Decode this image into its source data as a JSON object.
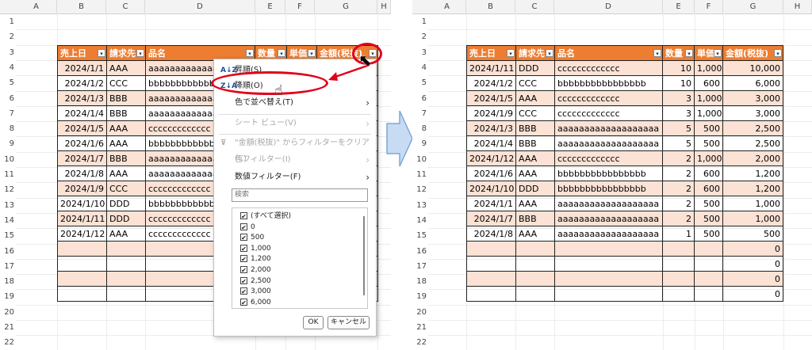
{
  "columns": [
    "A",
    "B",
    "C",
    "D",
    "E",
    "F",
    "G",
    "H"
  ],
  "rows": [
    "1",
    "2",
    "3",
    "4",
    "5",
    "6",
    "7",
    "8",
    "9",
    "10",
    "11",
    "12",
    "13",
    "14",
    "15",
    "16",
    "17",
    "18",
    "19",
    "20",
    "21",
    "22",
    "23"
  ],
  "headers": [
    "売上日",
    "請求先",
    "品名",
    "数量",
    "単価",
    "金額(税抜)"
  ],
  "left_table": [
    [
      "2024/1/1",
      "AAA",
      "aaaaaaaaaaaaaa"
    ],
    [
      "2024/1/2",
      "CCC",
      "bbbbbbbbbbbbb"
    ],
    [
      "2024/1/3",
      "BBB",
      "aaaaaaaaaaaaaa"
    ],
    [
      "2024/1/4",
      "BBB",
      "aaaaaaaaaaaaaa"
    ],
    [
      "2024/1/5",
      "AAA",
      "ccccccccccccc"
    ],
    [
      "2024/1/6",
      "AAA",
      "bbbbbbbbbbbbb"
    ],
    [
      "2024/1/7",
      "BBB",
      "aaaaaaaaaaaaaa"
    ],
    [
      "2024/1/8",
      "AAA",
      "aaaaaaaaaaaaaa"
    ],
    [
      "2024/1/9",
      "CCC",
      "ccccccccccccc"
    ],
    [
      "2024/1/10",
      "DDD",
      "bbbbbbbbbbbbb"
    ],
    [
      "2024/1/11",
      "DDD",
      "ccccccccccccc"
    ],
    [
      "2024/1/12",
      "AAA",
      "ccccccccccccc"
    ]
  ],
  "right_table": [
    [
      "2024/1/11",
      "DDD",
      "ccccccccccccc",
      "10",
      "1,000",
      "10,000"
    ],
    [
      "2024/1/2",
      "CCC",
      "bbbbbbbbbbbbbbbb",
      "10",
      "600",
      "6,000"
    ],
    [
      "2024/1/5",
      "AAA",
      "ccccccccccccc",
      "3",
      "1,000",
      "3,000"
    ],
    [
      "2024/1/9",
      "CCC",
      "ccccccccccccc",
      "3",
      "1,000",
      "3,000"
    ],
    [
      "2024/1/3",
      "BBB",
      "aaaaaaaaaaaaaaaaaaa",
      "5",
      "500",
      "2,500"
    ],
    [
      "2024/1/4",
      "BBB",
      "aaaaaaaaaaaaaaaaaaa",
      "5",
      "500",
      "2,500"
    ],
    [
      "2024/1/12",
      "AAA",
      "ccccccccccccc",
      "2",
      "1,000",
      "2,000"
    ],
    [
      "2024/1/6",
      "AAA",
      "bbbbbbbbbbbbbbbb",
      "2",
      "600",
      "1,200"
    ],
    [
      "2024/1/10",
      "DDD",
      "bbbbbbbbbbbbbbbb",
      "2",
      "600",
      "1,200"
    ],
    [
      "2024/1/1",
      "AAA",
      "aaaaaaaaaaaaaaaaaaa",
      "2",
      "500",
      "1,000"
    ],
    [
      "2024/1/7",
      "BBB",
      "aaaaaaaaaaaaaaaaaaa",
      "2",
      "500",
      "1,000"
    ],
    [
      "2024/1/8",
      "AAA",
      "aaaaaaaaaaaaaaaaaaa",
      "1",
      "500",
      "500"
    ],
    [
      "",
      "",
      "",
      "",
      "",
      "0"
    ],
    [
      "",
      "",
      "",
      "",
      "",
      "0"
    ],
    [
      "",
      "",
      "",
      "",
      "",
      "0"
    ],
    [
      "",
      "",
      "",
      "",
      "",
      "0"
    ]
  ],
  "menu": {
    "sort_asc": "昇順(S)",
    "sort_desc": "降順(O)",
    "sort_by_color": "色で並べ替え(T)",
    "sheet_view": "シート ビュー(V)",
    "clear_filter": "\"金額(税抜)\" からフィルターをクリア(C)",
    "color_filter": "色フィルター(I)",
    "number_filter": "数値フィルター(F)",
    "search_placeholder": "検索",
    "items": [
      "(すべて選択)",
      "0",
      "500",
      "1,000",
      "1,200",
      "2,000",
      "2,500",
      "3,000",
      "6,000"
    ],
    "ok": "OK",
    "cancel": "キャンセル"
  },
  "colors": {
    "header": "#ed7d31",
    "band": "#fbe2d5",
    "annotation": "#e0001a",
    "arrow": "#c7dcf2"
  }
}
